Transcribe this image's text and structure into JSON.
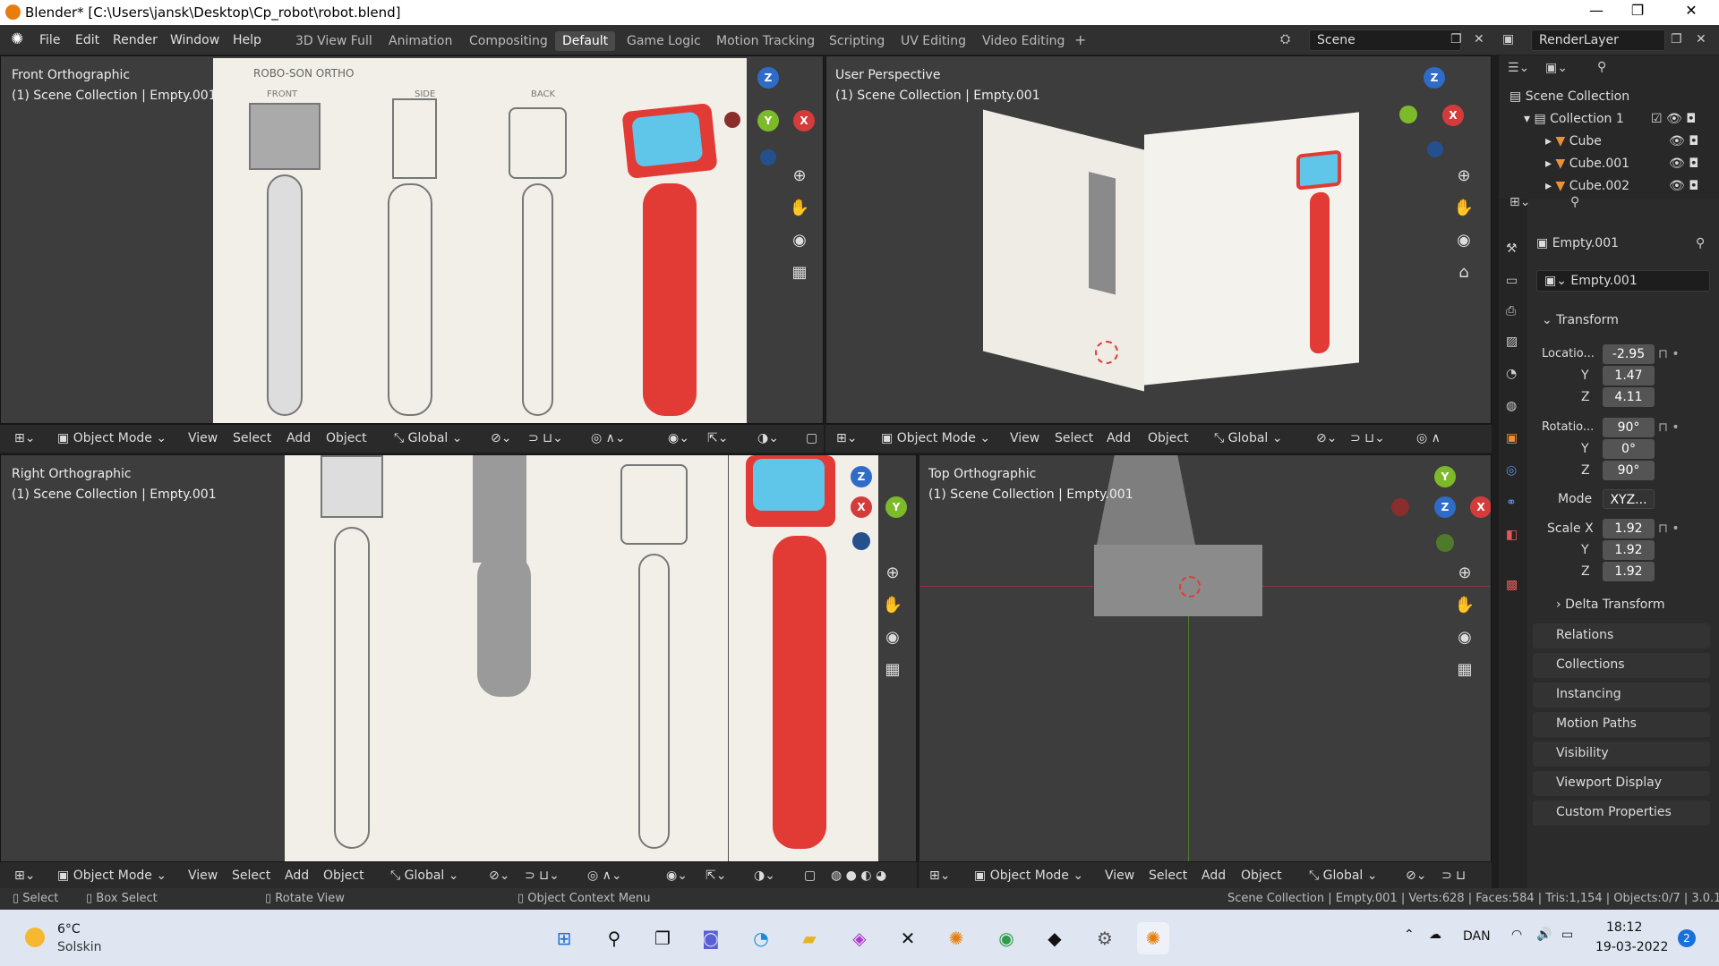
{
  "window": {
    "title": "Blender* [C:\\Users\\jansk\\Desktop\\Cp_robot\\robot.blend]",
    "minimize": "—",
    "maximize": "❐",
    "close": "✕"
  },
  "menu": [
    "File",
    "Edit",
    "Render",
    "Window",
    "Help"
  ],
  "workspaces": [
    "3D View Full",
    "Animation",
    "Compositing",
    "Default",
    "Game Logic",
    "Motion Tracking",
    "Scripting",
    "UV Editing",
    "Video Editing",
    "+"
  ],
  "scene": "Scene",
  "render_layer": "RenderLayer",
  "viewports": {
    "front": {
      "name": "Front Orthographic",
      "sub": "(1) Scene Collection | Empty.001"
    },
    "user": {
      "name": "User Perspective",
      "sub": "(1) Scene Collection | Empty.001"
    },
    "right": {
      "name": "Right Orthographic",
      "sub": "(1) Scene Collection | Empty.001"
    },
    "top": {
      "name": "Top Orthographic",
      "sub": "(1) Scene Collection | Empty.001"
    }
  },
  "header": {
    "mode": "Object Mode",
    "view": "View",
    "select": "Select",
    "add": "Add",
    "object": "Object",
    "orientation": "Global"
  },
  "gizmo": {
    "x": "X",
    "y": "Y",
    "z": "Z"
  },
  "outliner": {
    "root": "Scene Collection",
    "collection": "Collection 1",
    "items": [
      "Cube",
      "Cube.001",
      "Cube.002"
    ]
  },
  "props": {
    "object_name": "Empty.001",
    "data_name": "Empty.001",
    "transform": "Transform",
    "location_label": "Locatio...",
    "rotation_label": "Rotatio...",
    "scale_label": "Scale X",
    "y_label": "Y",
    "z_label": "Z",
    "location": [
      "-2.95",
      "1.47",
      "4.11"
    ],
    "rotation": [
      "90°",
      "0°",
      "90°"
    ],
    "mode_label": "Mode",
    "mode_value": "XYZ...",
    "scale": [
      "1.92",
      "1.92",
      "1.92"
    ],
    "delta": "Delta Transform",
    "panels": [
      "Relations",
      "Collections",
      "Instancing",
      "Motion Paths",
      "Visibility",
      "Viewport Display",
      "Custom Properties"
    ]
  },
  "status": {
    "select": "Select",
    "box_select": "Box Select",
    "rotate": "Rotate View",
    "context": "Object Context Menu",
    "info": "Scene Collection | Empty.001 | Verts:628 | Faces:584 | Tris:1,154 | Objects:0/7 | 3.0.1"
  },
  "taskbar": {
    "temp": "6°C",
    "weather": "Solskin",
    "lang": "DAN",
    "time": "18:12",
    "date": "19-03-2022",
    "badge": "2"
  },
  "sketch": {
    "title": "ROBO-SON  ORTHO",
    "front": "FRONT",
    "side": "SIDE",
    "back": "BACK"
  }
}
